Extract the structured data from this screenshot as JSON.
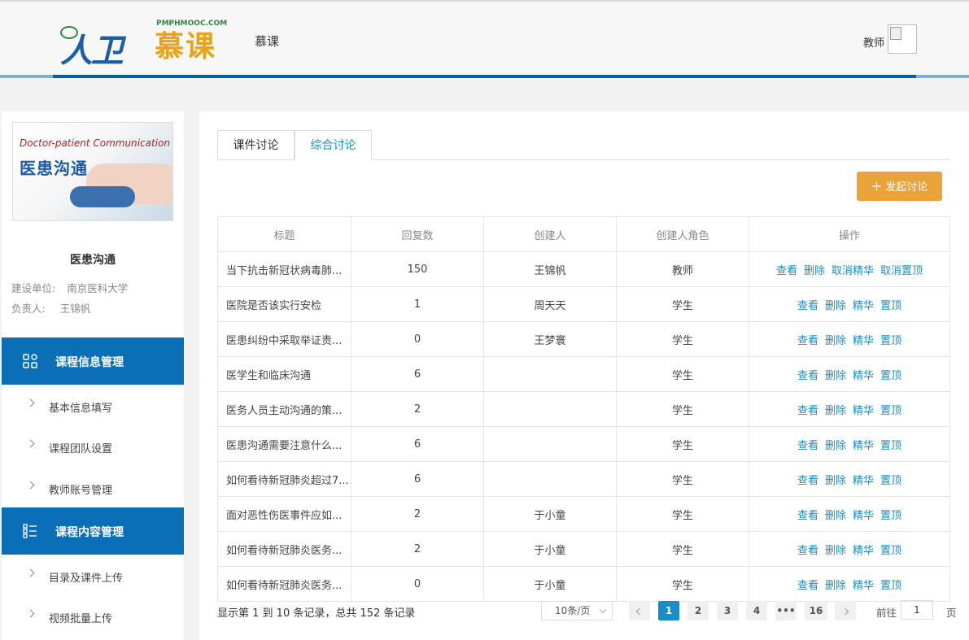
{
  "header": {
    "logo_main": "人卫",
    "logo_mu": "慕课",
    "logo_sub": "PMPHMOOC.COM",
    "site_title": "慕课",
    "role": "教师"
  },
  "sidebar": {
    "course_cover_en": "Doctor-patient  Communication",
    "course_cover_cn": "医患沟通",
    "course_name": "医患沟通",
    "unit_label": "建设单位:",
    "unit_value": "南京医科大学",
    "owner_label": "负责人:",
    "owner_value": "王锦帆",
    "menu1": {
      "label": "课程信息管理",
      "icon": "grid-icon",
      "items": [
        {
          "label": "基本信息填写"
        },
        {
          "label": "课程团队设置"
        },
        {
          "label": "教师账号管理"
        }
      ]
    },
    "menu2": {
      "label": "课程内容管理",
      "icon": "list-icon",
      "items": [
        {
          "label": "目录及课件上传"
        },
        {
          "label": "视频批量上传"
        }
      ]
    }
  },
  "main": {
    "tabs": [
      {
        "label": "课件讨论",
        "active": false
      },
      {
        "label": "综合讨论",
        "active": true
      }
    ],
    "new_button": "发起讨论",
    "columns": [
      "标题",
      "回复数",
      "创建人",
      "创建人角色",
      "操作"
    ],
    "rows": [
      {
        "title": "当下抗击新冠状病毒肺...",
        "replies": "150",
        "creator": "王锦帆",
        "role": "教师",
        "ops": [
          "查看",
          "删除",
          "取消精华",
          "取消置顶"
        ]
      },
      {
        "title": "医院是否该实行安检",
        "replies": "1",
        "creator": "周天天",
        "role": "学生",
        "ops": [
          "查看",
          "删除",
          "精华",
          "置顶"
        ]
      },
      {
        "title": "医患纠纷中采取举证责...",
        "replies": "0",
        "creator": "王梦寰",
        "role": "学生",
        "ops": [
          "查看",
          "删除",
          "精华",
          "置顶"
        ]
      },
      {
        "title": "医学生和临床沟通",
        "replies": "6",
        "creator": "",
        "role": "学生",
        "ops": [
          "查看",
          "删除",
          "精华",
          "置顶"
        ]
      },
      {
        "title": "医务人员主动沟通的策...",
        "replies": "2",
        "creator": "",
        "role": "学生",
        "ops": [
          "查看",
          "删除",
          "精华",
          "置顶"
        ]
      },
      {
        "title": "医患沟通需要注意什么...",
        "replies": "6",
        "creator": "",
        "role": "学生",
        "ops": [
          "查看",
          "删除",
          "精华",
          "置顶"
        ]
      },
      {
        "title": "如何看待新冠肺炎超过7...",
        "replies": "6",
        "creator": "",
        "role": "学生",
        "ops": [
          "查看",
          "删除",
          "精华",
          "置顶"
        ]
      },
      {
        "title": "面对恶性伤医事件应如...",
        "replies": "2",
        "creator": "于小童",
        "role": "学生",
        "ops": [
          "查看",
          "删除",
          "精华",
          "置顶"
        ]
      },
      {
        "title": "如何看待新冠肺炎医务...",
        "replies": "2",
        "creator": "于小童",
        "role": "学生",
        "ops": [
          "查看",
          "删除",
          "精华",
          "置顶"
        ]
      },
      {
        "title": "如何看待新冠肺炎医务...",
        "replies": "0",
        "creator": "于小童",
        "role": "学生",
        "ops": [
          "查看",
          "删除",
          "精华",
          "置顶"
        ]
      }
    ],
    "pager": {
      "info": "显示第 1 到 10 条记录，总共 152 条记录",
      "page_size": "10条/页",
      "pages": [
        "1",
        "2",
        "3",
        "4",
        "•••",
        "16"
      ],
      "current": "1",
      "goto_label": "前往",
      "goto_value": "1",
      "goto_suffix": "页"
    }
  }
}
